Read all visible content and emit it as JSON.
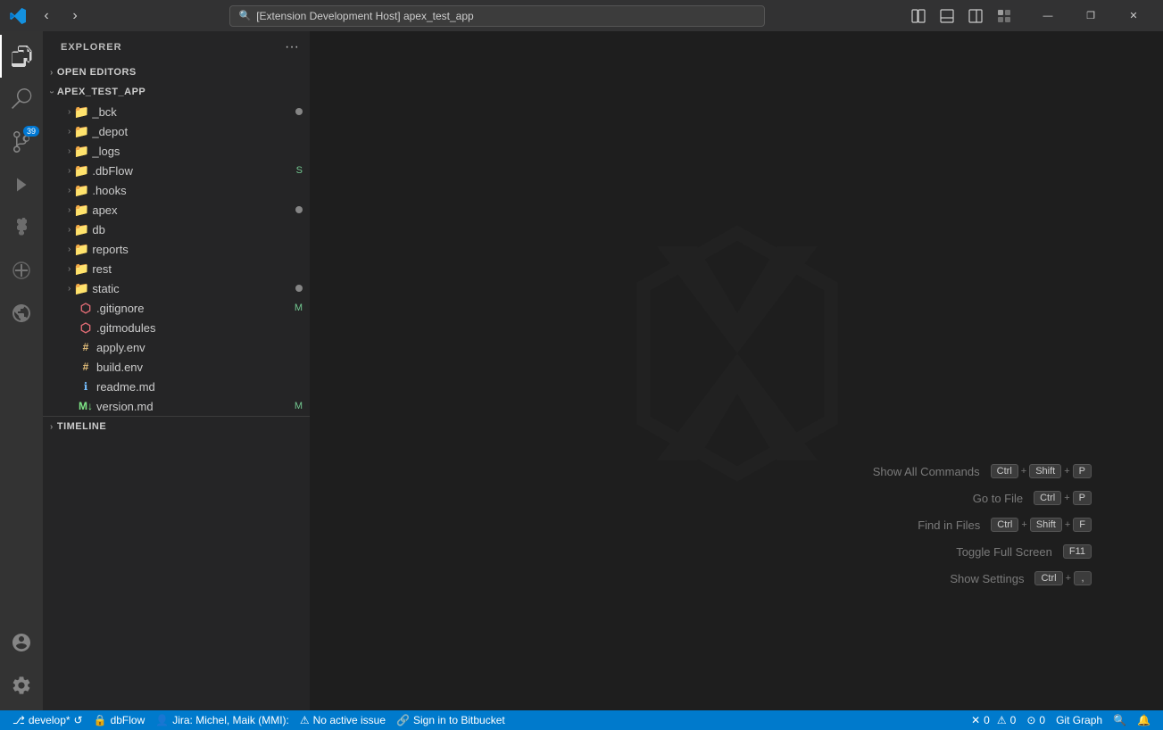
{
  "titlebar": {
    "search_text": "[Extension Development Host] apex_test_app",
    "nav_back": "‹",
    "nav_forward": "›",
    "search_icon": "🔍",
    "icon_sidebar": "sidebar",
    "icon_panel": "panel",
    "icon_layout": "layout",
    "icon_customize": "customize",
    "win_minimize": "—",
    "win_restore": "❐",
    "win_close": "✕"
  },
  "activity_bar": {
    "items": [
      {
        "name": "explorer",
        "icon": "files",
        "active": true
      },
      {
        "name": "search",
        "icon": "search"
      },
      {
        "name": "source-control",
        "icon": "source-control",
        "badge": "39"
      },
      {
        "name": "run",
        "icon": "run"
      },
      {
        "name": "extensions",
        "icon": "extensions"
      },
      {
        "name": "test",
        "icon": "test"
      },
      {
        "name": "remote-explorer",
        "icon": "remote"
      },
      {
        "name": "accounts",
        "icon": "account"
      },
      {
        "name": "settings",
        "icon": "settings"
      }
    ]
  },
  "sidebar": {
    "title": "Explorer",
    "more_btn": "···",
    "sections": {
      "open_editors": "Open Editors",
      "project": "APEX_TEST_APP"
    },
    "tree_items": [
      {
        "id": "bck",
        "label": "_bck",
        "type": "folder",
        "indent": 1,
        "dot": true
      },
      {
        "id": "depot",
        "label": "_depot",
        "type": "folder",
        "indent": 1
      },
      {
        "id": "logs",
        "label": "_logs",
        "type": "folder",
        "indent": 1
      },
      {
        "id": "dbflow",
        "label": ".dbFlow",
        "type": "folder-blue",
        "indent": 1,
        "badge": "S"
      },
      {
        "id": "hooks",
        "label": ".hooks",
        "type": "folder-blue",
        "indent": 1
      },
      {
        "id": "apex",
        "label": "apex",
        "type": "folder",
        "indent": 1,
        "dot": true
      },
      {
        "id": "db",
        "label": "db",
        "type": "folder",
        "indent": 1
      },
      {
        "id": "reports",
        "label": "reports",
        "type": "folder",
        "indent": 1
      },
      {
        "id": "rest",
        "label": "rest",
        "type": "folder",
        "indent": 1
      },
      {
        "id": "static",
        "label": "static",
        "type": "folder-orange",
        "indent": 1,
        "dot": true
      },
      {
        "id": "gitignore",
        "label": ".gitignore",
        "type": "git-red",
        "indent": 1,
        "badge": "M"
      },
      {
        "id": "gitmodules",
        "label": ".gitmodules",
        "type": "git-red",
        "indent": 1
      },
      {
        "id": "apply-env",
        "label": "apply.env",
        "type": "file-env",
        "indent": 1
      },
      {
        "id": "build-env",
        "label": "build.env",
        "type": "file-env",
        "indent": 1
      },
      {
        "id": "readme",
        "label": "readme.md",
        "type": "file-info",
        "indent": 1
      },
      {
        "id": "version",
        "label": "version.md",
        "type": "file-md2",
        "indent": 1,
        "badge": "M"
      }
    ],
    "timeline_label": "TIMELINE"
  },
  "shortcuts": [
    {
      "label": "Show All Commands",
      "keys": [
        "Ctrl",
        "+",
        "Shift",
        "+",
        "P"
      ]
    },
    {
      "label": "Go to File",
      "keys": [
        "Ctrl",
        "+",
        "P"
      ]
    },
    {
      "label": "Find in Files",
      "keys": [
        "Ctrl",
        "+",
        "Shift",
        "+",
        "F"
      ]
    },
    {
      "label": "Toggle Full Screen",
      "keys": [
        "F11"
      ]
    },
    {
      "label": "Show Settings",
      "keys": [
        "Ctrl",
        "+",
        ","
      ]
    }
  ],
  "status_bar": {
    "branch": "develop*",
    "sync_icon": "↺",
    "db_icon": "🔒",
    "db_label": "dbFlow",
    "jira_icon": "👤",
    "jira_label": "Jira: Michel, Maik (MMI):",
    "issues_icon": "⚠",
    "no_issues": "No active issue",
    "sign_in_icon": "🔗",
    "sign_in_label": "Sign in to Bitbucket",
    "errors": "0",
    "warnings": "0",
    "ports": "0",
    "git_graph": "Git Graph",
    "zoom_icon": "🔍",
    "bell_icon": "🔔"
  }
}
